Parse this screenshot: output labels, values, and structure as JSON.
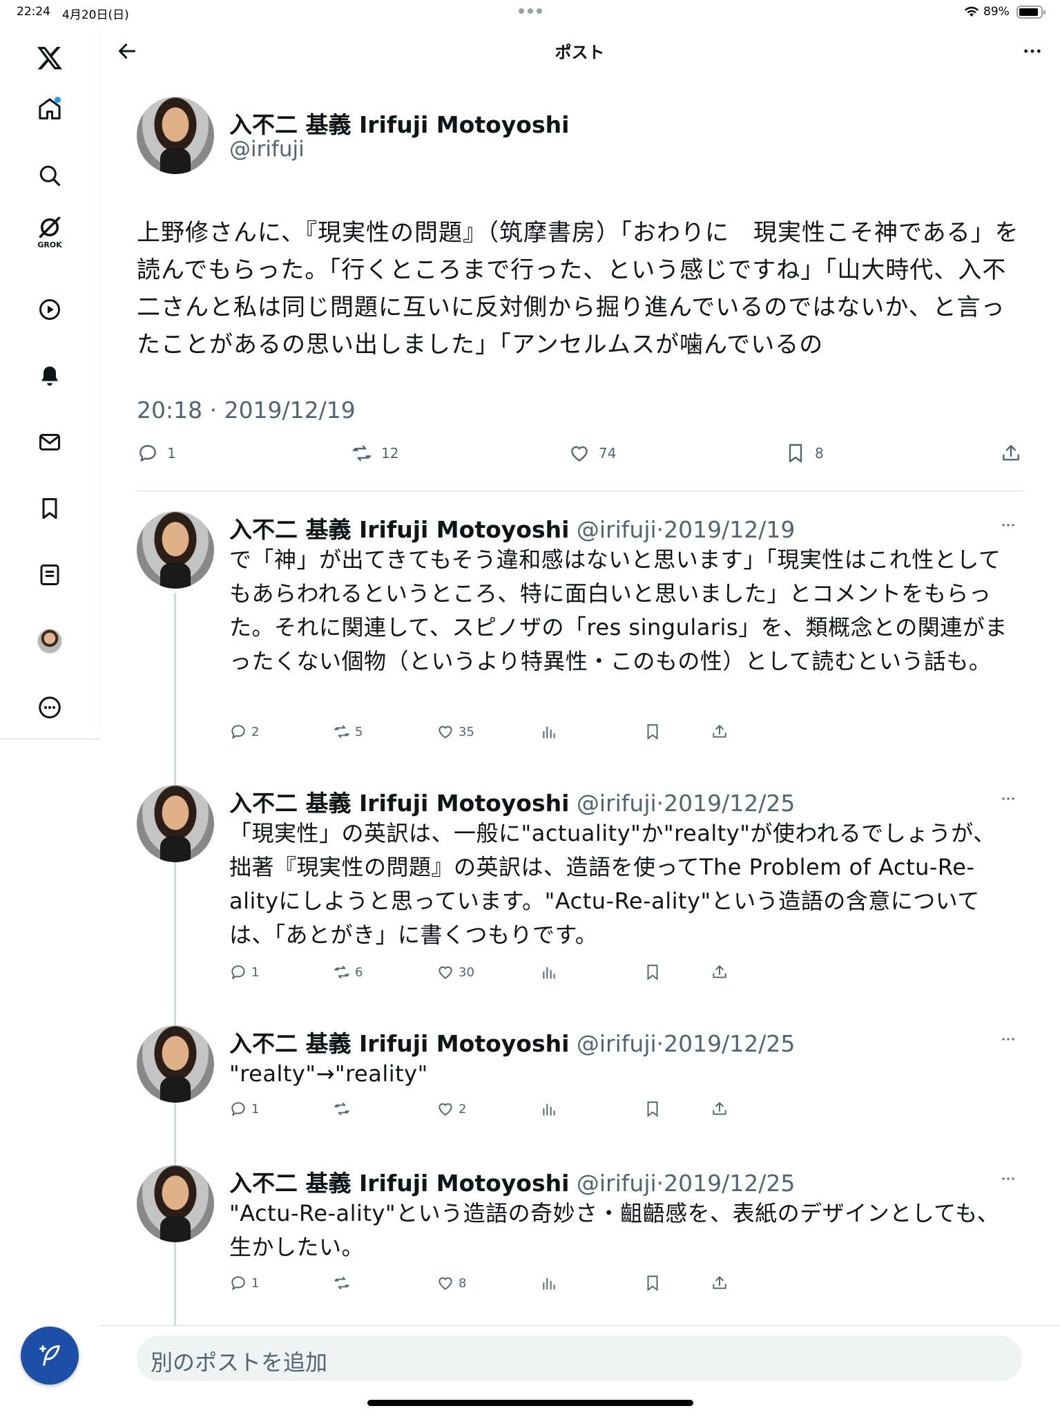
{
  "status_bar": {
    "time": "22:24",
    "date": "4月20日(日)",
    "battery": "89%",
    "battery_level": 0.89
  },
  "header": {
    "title": "ポスト"
  },
  "sidebar": {
    "grok_label": "GROK"
  },
  "main_post": {
    "name": "入不二 基義 Irifuji Motoyoshi",
    "handle": "@irifuji",
    "text": "上野修さんに、『現実性の問題』（筑摩書房）「おわりに　現実性こそ神である」を読んでもらった。「行くところまで行った、という感じですね」「山大時代、入不二さんと私は同じ問題に互いに反対側から掘り進んでいるのではないか、と言ったことがあるの思い出しました」「アンセルムスが噛んでいるの",
    "timestamp": "20:18 · 2019/12/19",
    "stats": {
      "replies": "1",
      "reposts": "12",
      "likes": "74",
      "bookmarks": "8"
    }
  },
  "replies": [
    {
      "name": "入不二 基義 Irifuji Motoyoshi",
      "handle": "@irifuji",
      "sep": "·",
      "date": "2019/12/19",
      "text": "で「神」が出てきてもそう違和感はないと思います」「現実性はこれ性としてもあらわれるというところ、特に面白いと思いました」とコメントをもらった。それに関連して、スピノザの「res singularis」を、類概念との関連がまったくない個物（というより特異性・このもの性）として読むという話も。",
      "replies": "2",
      "reposts": "5",
      "likes": "35"
    },
    {
      "name": "入不二 基義 Irifuji Motoyoshi",
      "handle": "@irifuji",
      "sep": "·",
      "date": "2019/12/25",
      "text": "「現実性」の英訳は、一般に\"actuality\"か\"realty\"が使われるでしょうが、拙著『現実性の問題』の英訳は、造語を使ってThe Problem of Actu-Re-alityにしようと思っています。\"Actu-Re-ality\"という造語の含意については、「あとがき」に書くつもりです。",
      "replies": "1",
      "reposts": "6",
      "likes": "30"
    },
    {
      "name": "入不二 基義 Irifuji Motoyoshi",
      "handle": "@irifuji",
      "sep": "·",
      "date": "2019/12/25",
      "text": "\"realty\"→\"reality\"",
      "replies": "1",
      "reposts": "",
      "likes": "2"
    },
    {
      "name": "入不二 基義 Irifuji Motoyoshi",
      "handle": "@irifuji",
      "sep": "·",
      "date": "2019/12/25",
      "text": "\"Actu-Re-ality\"という造語の奇妙さ・齟齬感を、表紙のデザインとしても、生かしたい。",
      "replies": "1",
      "reposts": "",
      "likes": "8"
    }
  ],
  "composer": {
    "placeholder": "別のポストを追加"
  },
  "colors": {
    "accent": "#1d9bf0",
    "fab": "#1d4fa8",
    "secondary_text": "#536471"
  }
}
